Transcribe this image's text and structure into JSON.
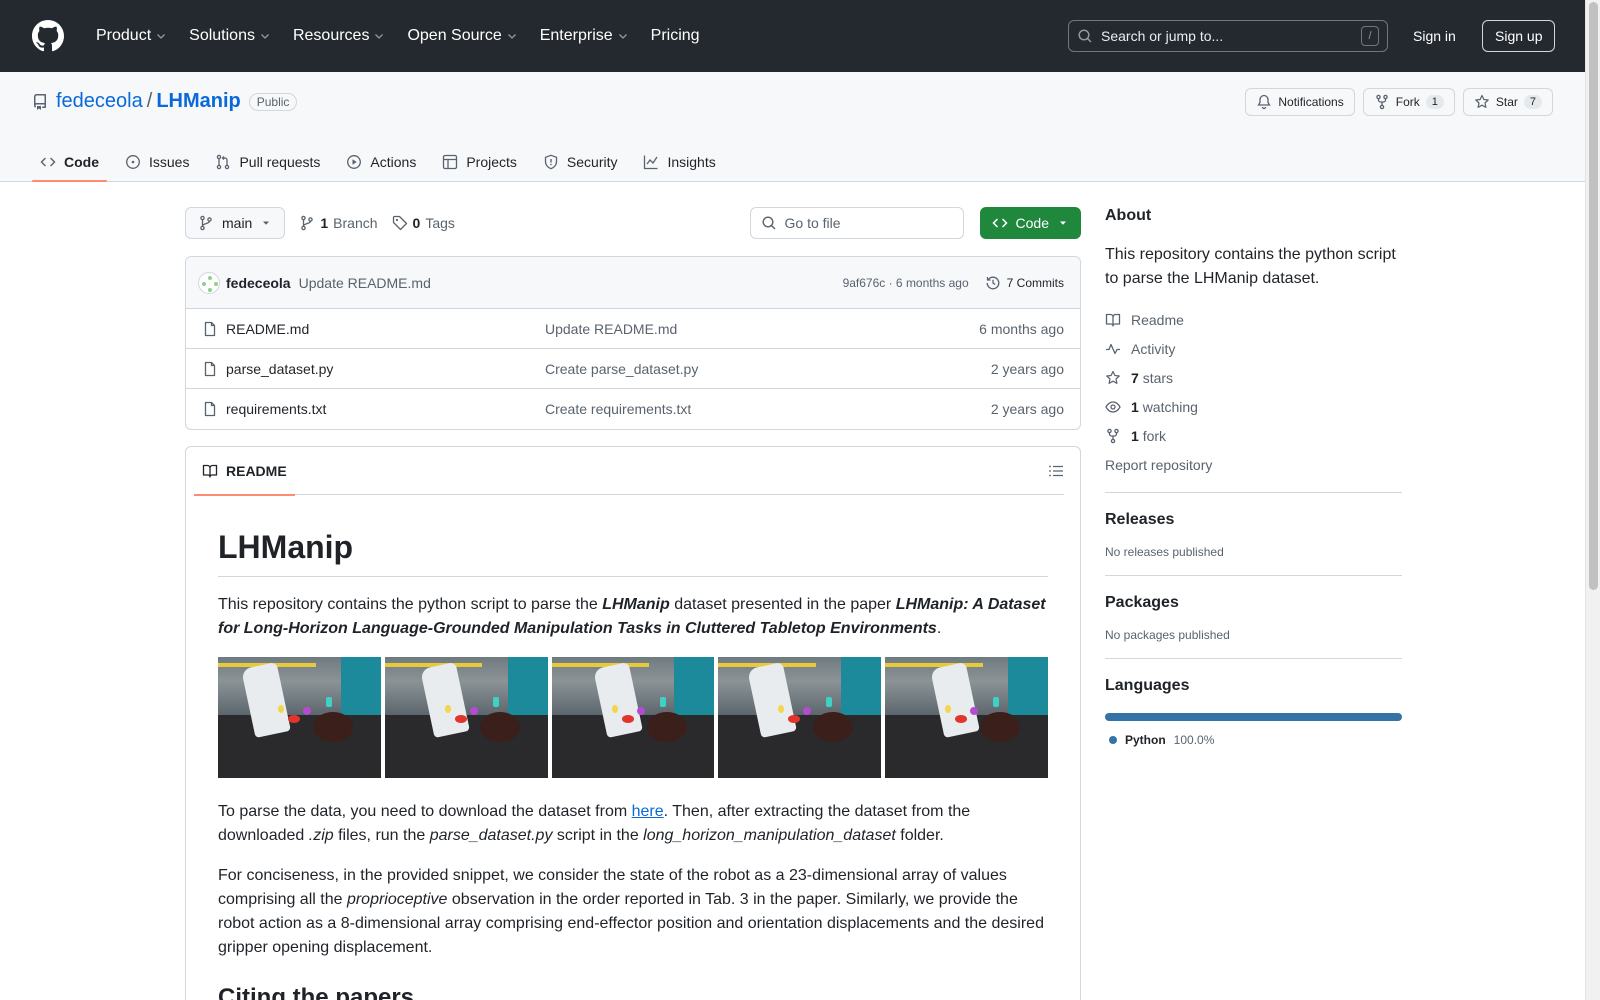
{
  "header": {
    "nav": [
      "Product",
      "Solutions",
      "Resources",
      "Open Source",
      "Enterprise",
      "Pricing"
    ],
    "search_placeholder": "Search or jump to...",
    "search_shortcut": "/",
    "sign_in": "Sign in",
    "sign_up": "Sign up"
  },
  "repo": {
    "owner": "fedeceola",
    "separator": "/",
    "name": "LHManip",
    "visibility": "Public",
    "notifications_label": "Notifications",
    "fork_label": "Fork",
    "fork_count": "1",
    "star_label": "Star",
    "star_count": "7",
    "tabs": [
      "Code",
      "Issues",
      "Pull requests",
      "Actions",
      "Projects",
      "Security",
      "Insights"
    ]
  },
  "toolbar": {
    "branch": "main",
    "branch_count": "1",
    "branch_label": "Branch",
    "tag_count": "0",
    "tag_label": "Tags",
    "goto_placeholder": "Go to file",
    "code_label": "Code"
  },
  "commit": {
    "author": "fedeceola",
    "message": "Update README.md",
    "hash_time": "9af676c · 6 months ago",
    "count": "7 Commits"
  },
  "files": [
    {
      "name": "README.md",
      "commit": "Update README.md",
      "date": "6 months ago"
    },
    {
      "name": "parse_dataset.py",
      "commit": "Create parse_dataset.py",
      "date": "2 years ago"
    },
    {
      "name": "requirements.txt",
      "commit": "Create requirements.txt",
      "date": "2 years ago"
    }
  ],
  "readme": {
    "tab_label": "README",
    "title": "LHManip",
    "p1_a": "This repository contains the python script to parse the ",
    "p1_b": "LHManip",
    "p1_c": " dataset presented in the paper ",
    "p1_d": "LHManip: A Dataset for Long-Horizon Language-Grounded Manipulation Tasks in Cluttered Tabletop Environments",
    "p1_e": ".",
    "p2_a": "To parse the data, you need to download the dataset from ",
    "p2_link": "here",
    "p2_b": ". Then, after extracting the dataset from the downloaded ",
    "p2_zip": ".zip",
    "p2_c": " files, run the ",
    "p2_script": "parse_dataset.py",
    "p2_d": " script in the ",
    "p2_folder": "long_horizon_manipulation_dataset",
    "p2_e": " folder.",
    "p3_a": "For conciseness, in the provided snippet, we consider the state of the robot as a 23-dimensional array of values comprising all the ",
    "p3_em": "proprioceptive",
    "p3_b": " observation in the order reported in Tab. 3 in the paper. Similarly, we provide the robot action as a 8-dimensional array comprising end-effector position and orientation displacements and the desired gripper opening displacement.",
    "h2": "Citing the papers"
  },
  "about": {
    "heading": "About",
    "description": "This repository contains the python script to parse the LHManip dataset.",
    "readme": "Readme",
    "activity": "Activity",
    "stars_count": "7",
    "stars_label": "stars",
    "watching_count": "1",
    "watching_label": "watching",
    "fork_count": "1",
    "fork_label": "fork",
    "report": "Report repository"
  },
  "releases": {
    "heading": "Releases",
    "text": "No releases published"
  },
  "packages": {
    "heading": "Packages",
    "text": "No packages published"
  },
  "languages": {
    "heading": "Languages",
    "items": [
      {
        "name": "Python",
        "percent": "100.0%",
        "color": "#3572a5"
      }
    ]
  },
  "colors": {
    "header_bg": "#24292f",
    "link": "#0969da",
    "code_button": "#1f883d",
    "tab_underline": "#fd8c73"
  }
}
